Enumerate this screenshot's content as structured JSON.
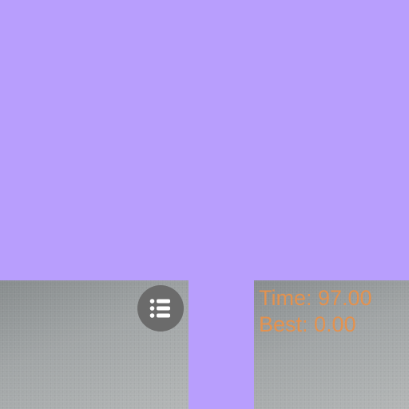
{
  "hud": {
    "time_text": "Time: 97.00",
    "best_text": "Best: 0.00"
  },
  "menu_button": {
    "icon": "list-icon"
  },
  "colors": {
    "background": "#b89efd",
    "hud_text": "#e3924f",
    "menu_button": "#6b6b6b"
  }
}
